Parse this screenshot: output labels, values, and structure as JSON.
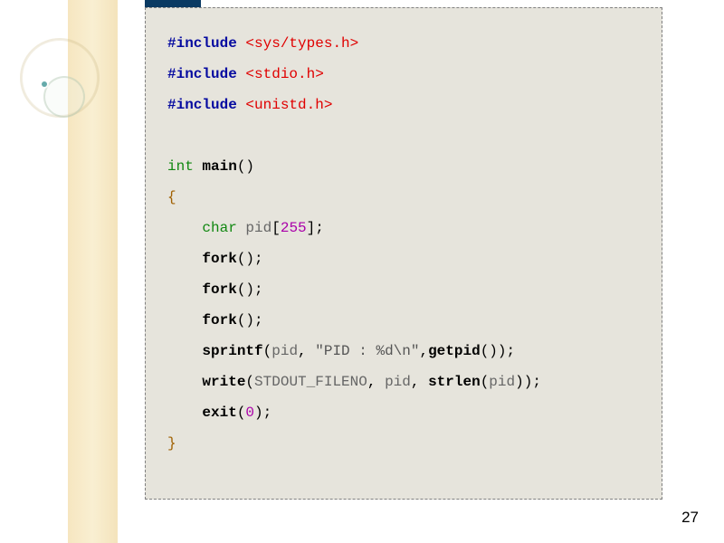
{
  "page_number": "27",
  "code": {
    "inc1_kw": "#include ",
    "inc1_hdr": "<sys/types.h>",
    "inc2_kw": "#include ",
    "inc2_hdr": "<stdio.h>",
    "inc3_kw": "#include ",
    "inc3_hdr": "<unistd.h>",
    "ty_int": "int",
    "main": " main",
    "parens": "()",
    "ob": "{",
    "cb": "}",
    "indent": "    ",
    "ty_char": "char",
    "sp": " ",
    "pid": "pid",
    "lbrk": "[",
    "n255": "255",
    "rbrk": "];",
    "fork": "fork",
    "call_semi": "();",
    "sprintf": "sprintf",
    "lpar": "(",
    "comma": ", ",
    "str": "\"PID : %d\\n\"",
    "comma2": ",",
    "getpid": "getpid",
    "rpar2": "());",
    "write": "write",
    "stdout": "STDOUT_FILENO",
    "strlen": "strlen",
    "rpar3": "));",
    "exit": "exit",
    "n0": "0",
    "rpar1": ");"
  }
}
